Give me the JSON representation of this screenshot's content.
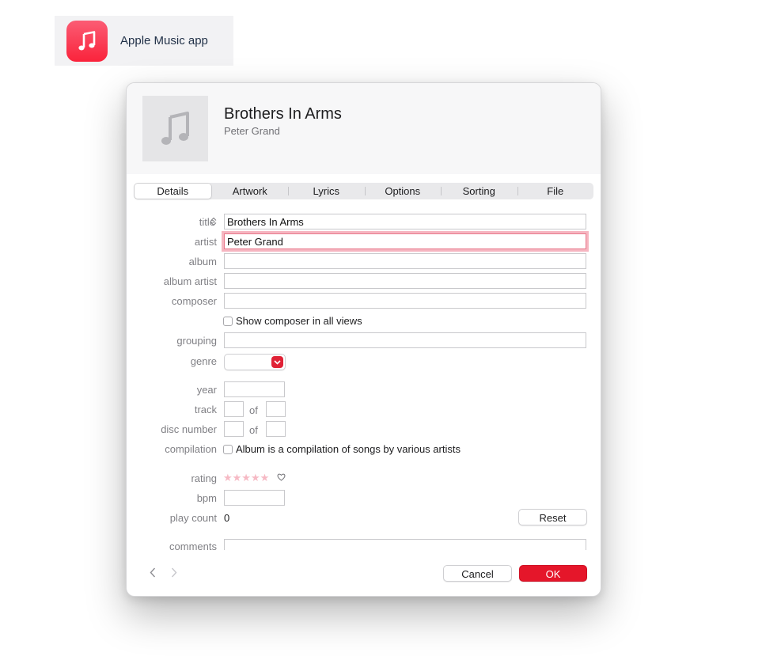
{
  "app_badge": {
    "label": "Apple Music app",
    "icon": "music-note-icon",
    "color": "#fa233b"
  },
  "header": {
    "title": "Brothers In Arms",
    "artist": "Peter Grand",
    "artwork_icon": "music-note-icon"
  },
  "tabs": [
    {
      "label": "Details",
      "active": true
    },
    {
      "label": "Artwork"
    },
    {
      "label": "Lyrics"
    },
    {
      "label": "Options"
    },
    {
      "label": "Sorting"
    },
    {
      "label": "File"
    }
  ],
  "form": {
    "title_label": "title",
    "title_value": "Brothers In Arms",
    "artist_label": "artist",
    "artist_value": "Peter Grand",
    "album_label": "album",
    "album_value": "",
    "album_artist_label": "album artist",
    "album_artist_value": "",
    "composer_label": "composer",
    "composer_value": "",
    "show_composer_label": "Show composer in all views",
    "grouping_label": "grouping",
    "grouping_value": "",
    "genre_label": "genre",
    "genre_value": "",
    "year_label": "year",
    "year_value": "",
    "track_label": "track",
    "track_of": "of",
    "disc_label": "disc number",
    "disc_of": "of",
    "compilation_label": "compilation",
    "compilation_text": "Album is a compilation of songs by various artists",
    "rating_label": "rating",
    "rating_stars": "★★★★★",
    "rating_value": 0,
    "bpm_label": "bpm",
    "bpm_value": "",
    "play_count_label": "play count",
    "play_count_value": "0",
    "reset_label": "Reset",
    "comments_label": "comments"
  },
  "footer": {
    "cancel_label": "Cancel",
    "ok_label": "OK",
    "accent": "#e5162a"
  }
}
